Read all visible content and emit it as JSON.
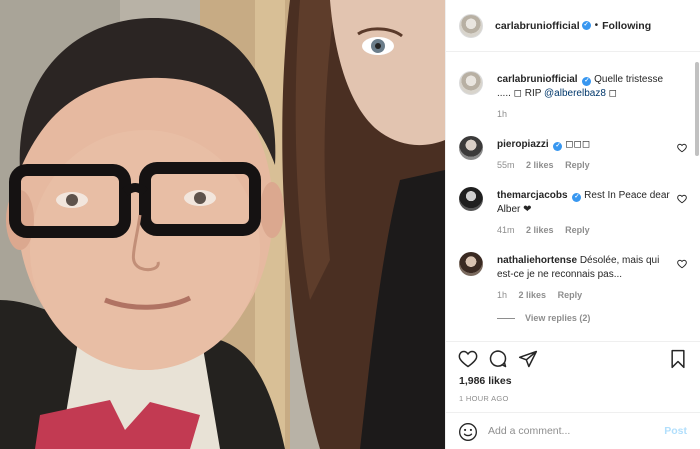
{
  "post": {
    "author": "carlabruniofficial",
    "follow_separator": "•",
    "follow_status": "Following",
    "caption": {
      "user": "carlabruniofficial",
      "text": "Quelle tristesse ..... ◻ RIP",
      "mention": "@alberelbaz8",
      "tail": "◻",
      "age": "1h"
    },
    "comments": [
      {
        "user": "pieropiazzi",
        "text": "◻◻◻",
        "age": "55m",
        "likes": "2 likes",
        "reply": "Reply"
      },
      {
        "user": "themarcjacobs",
        "text": "Rest In Peace dear Alber ❤",
        "age": "41m",
        "likes": "2 likes",
        "reply": "Reply"
      },
      {
        "user": "nathaliehortense",
        "text": "Désolée, mais qui est-ce je ne reconnais pas...",
        "age": "1h",
        "likes": "2 likes",
        "reply": "Reply"
      }
    ],
    "view_replies": "View replies (2)",
    "likes": "1,986 likes",
    "timestamp": "1 HOUR AGO",
    "add_comment_placeholder": "Add a comment...",
    "post_button": "Post"
  },
  "icons": {
    "like": "heart-icon",
    "comment": "comment-bubble-icon",
    "share": "paper-plane-icon",
    "save": "bookmark-icon",
    "emoji": "smiley-icon",
    "verified": "verified-badge-icon"
  }
}
